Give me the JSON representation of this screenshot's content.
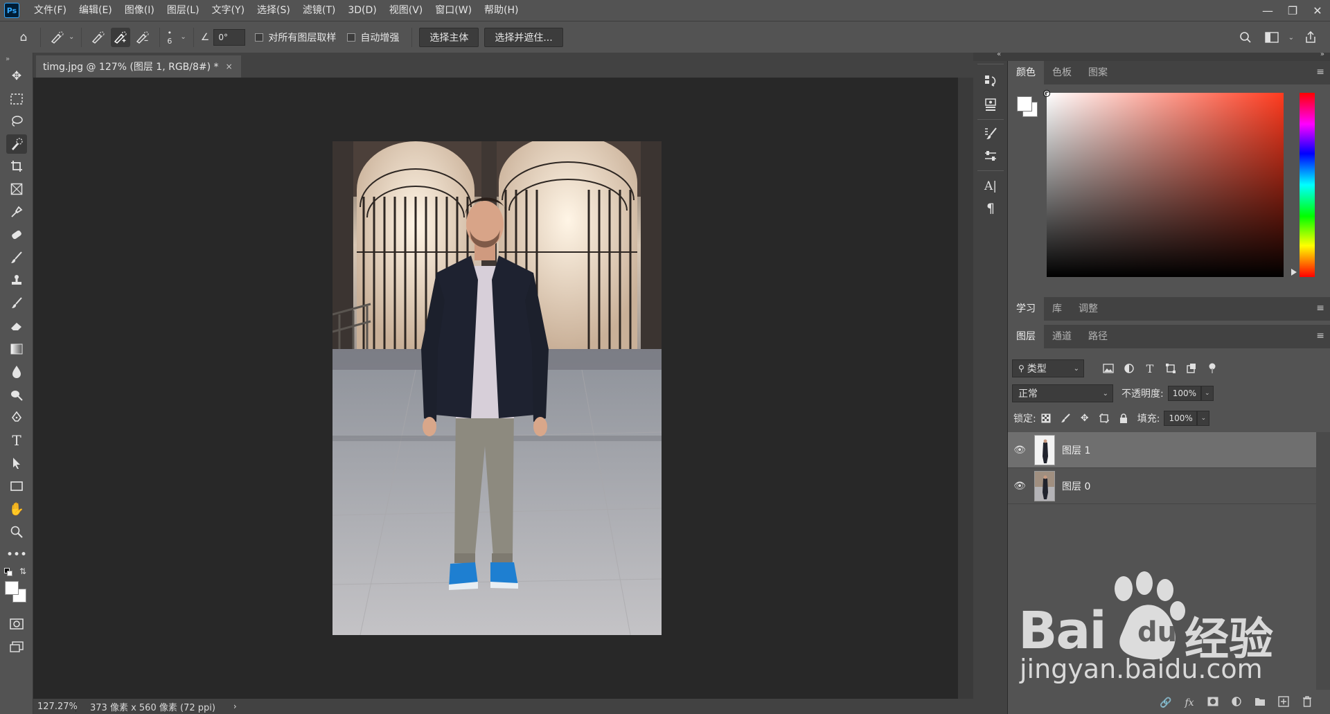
{
  "app": {
    "logo": "Ps",
    "menu": [
      "文件(F)",
      "编辑(E)",
      "图像(I)",
      "图层(L)",
      "文字(Y)",
      "选择(S)",
      "滤镜(T)",
      "3D(D)",
      "视图(V)",
      "窗口(W)",
      "帮助(H)"
    ]
  },
  "options": {
    "brush_size": "6",
    "angle": "0°",
    "sample_all_layers": "对所有图层取样",
    "auto_enhance": "自动增强",
    "select_subject": "选择主体",
    "select_and_mask": "选择并遮住..."
  },
  "document": {
    "tab_title": "timg.jpg @ 127% (图层 1, RGB/8#) *",
    "close_glyph": "×"
  },
  "status": {
    "zoom": "127.27%",
    "info": "373 像素 x 560 像素 (72 ppi)",
    "arrow": "›"
  },
  "color_panel": {
    "tabs": [
      "颜色",
      "色板",
      "图案"
    ],
    "active_tab": 0,
    "hue_color": "#ff3b1f"
  },
  "learn_panel": {
    "tabs": [
      "学习",
      "库",
      "调整"
    ],
    "active_tab": 0
  },
  "layers_panel": {
    "tabs": [
      "图层",
      "通道",
      "路径"
    ],
    "active_tab": 0,
    "filter_kind": "类型",
    "blend_mode": "正常",
    "opacity_label": "不透明度:",
    "opacity": "100%",
    "lock_label": "锁定:",
    "fill_label": "填充:",
    "fill": "100%",
    "layers": [
      {
        "name": "图层 1",
        "selected": true,
        "visible": true
      },
      {
        "name": "图层 0",
        "selected": false,
        "visible": true
      }
    ]
  },
  "watermark": {
    "brand": "Bai",
    "brand_du": "du",
    "brand_cn": "经验",
    "url": "jingyan.baidu.com"
  }
}
